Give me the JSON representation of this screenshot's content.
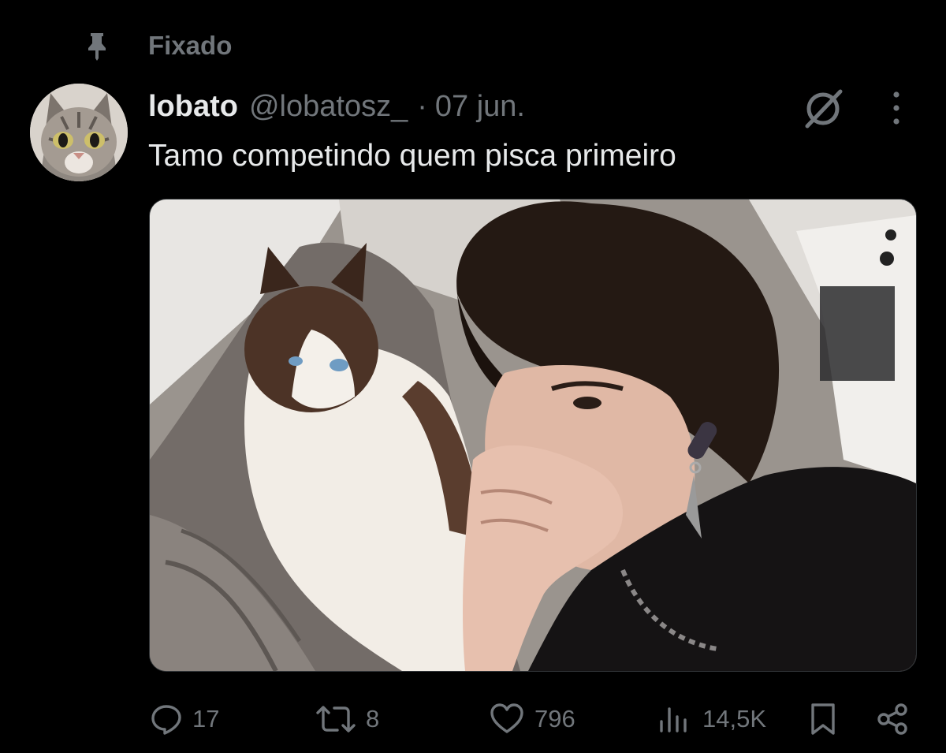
{
  "pinned": {
    "label": "Fixado",
    "icon": "pin-icon"
  },
  "tweet": {
    "display_name": "lobato",
    "handle": "@lobatosz_",
    "separator": "·",
    "date": "07 jun.",
    "text": "Tamo competindo quem pisca primeiro",
    "avatar_icon": "cat-avatar",
    "media_description_icon": "photo-image"
  },
  "actions": {
    "replies": {
      "icon": "reply-icon",
      "count": "17"
    },
    "reposts": {
      "icon": "repost-icon",
      "count": "8"
    },
    "likes": {
      "icon": "heart-icon",
      "count": "796"
    },
    "views": {
      "icon": "views-icon",
      "count": "14,5K"
    },
    "bookmark": {
      "icon": "bookmark-icon"
    },
    "share": {
      "icon": "share-icon"
    }
  },
  "colors": {
    "background": "#000000",
    "text_primary": "#e7e9ea",
    "text_secondary": "#71767b",
    "border": "#2f3336"
  }
}
